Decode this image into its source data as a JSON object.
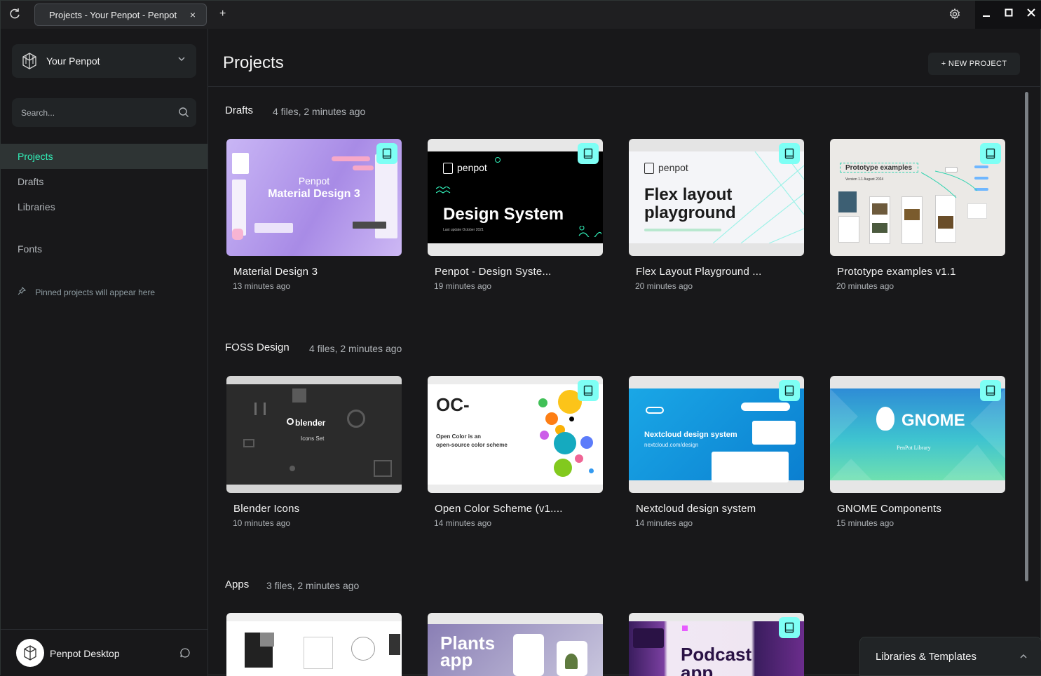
{
  "titlebar": {
    "tab_title": "Projects - Your Penpot - Penpot",
    "tab_close": "×",
    "new_tab": "+",
    "reload_icon": "reload-icon",
    "settings_icon": "gear-icon"
  },
  "sidebar": {
    "team": "Your Penpot",
    "search_placeholder": "Search...",
    "nav": [
      {
        "label": "Projects",
        "active": true
      },
      {
        "label": "Drafts",
        "active": false
      },
      {
        "label": "Libraries",
        "active": false
      },
      {
        "label": "Fonts",
        "active": false
      }
    ],
    "pinned_hint": "Pinned projects will appear here",
    "profile_name": "Penpot Desktop"
  },
  "main": {
    "title": "Projects",
    "new_project": "+ NEW PROJECT",
    "sections": [
      {
        "name": "Drafts",
        "meta": "4 files, 2 minutes ago",
        "files": [
          {
            "name": "Material Design 3",
            "date": "13 minutes ago",
            "library": true
          },
          {
            "name": "Penpot - Design Syste...",
            "date": "19 minutes ago",
            "library": true
          },
          {
            "name": "Flex Layout Playground ...",
            "date": "20 minutes ago",
            "library": true
          },
          {
            "name": "Prototype examples v1.1",
            "date": "20 minutes ago",
            "library": true
          }
        ]
      },
      {
        "name": "FOSS Design",
        "meta": "4 files, 2 minutes ago",
        "files": [
          {
            "name": "Blender Icons",
            "date": "10 minutes ago",
            "library": false
          },
          {
            "name": "Open Color Scheme (v1....",
            "date": "14 minutes ago",
            "library": true
          },
          {
            "name": "Nextcloud design system",
            "date": "14 minutes ago",
            "library": true
          },
          {
            "name": "GNOME Components",
            "date": "15 minutes ago",
            "library": true
          }
        ]
      },
      {
        "name": "Apps",
        "meta": "3 files, 2 minutes ago",
        "files": [
          {
            "name": "",
            "date": "",
            "library": false
          },
          {
            "name": "",
            "date": "",
            "library": false
          },
          {
            "name": "",
            "date": "",
            "library": true
          }
        ]
      }
    ],
    "thumbs": {
      "md3_brand": "Penpot",
      "md3_title": "Material Design 3",
      "ds_brand": "penpot",
      "ds_title": "Design System",
      "ds_sub": "Last update October 2021",
      "flex_brand": "penpot",
      "flex_title1": "Flex layout",
      "flex_title2": "playground",
      "proto_title": "Prototype examples",
      "proto_sub": "Version 1.1 August 2024",
      "blender_brand": "blender",
      "blender_sub": "Icons Set",
      "oc_title": "OC-",
      "oc_sub1": "Open Color is an",
      "oc_sub2": "open-source color scheme",
      "nc_title": "Nextcloud design system",
      "nc_url": "nextcloud.com/design",
      "gnome_title": "GNOME",
      "gnome_sub": "PenPot Library",
      "plants_title1": "Plants",
      "plants_title2": "app",
      "podcast_title1": "Podcast",
      "podcast_title2": "app"
    },
    "libraries_templates": "Libraries & Templates"
  },
  "colors": {
    "accent": "#31efb8",
    "library_badge": "#7efff5",
    "background": "#18181a",
    "surface": "#212426"
  }
}
